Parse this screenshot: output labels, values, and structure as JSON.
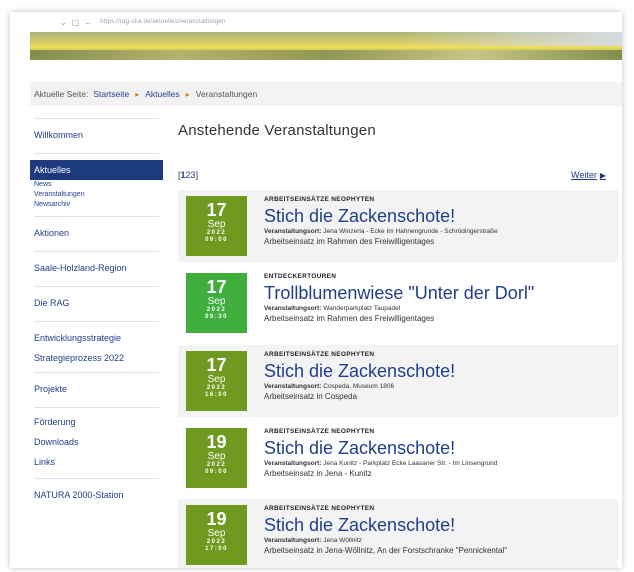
{
  "browser": {
    "url": "https://rag-sha.de/aktuelles/veranstaltungen"
  },
  "breadcrumb": {
    "label": "Aktuelle Seite:",
    "items": [
      "Startseite",
      "Aktuelles",
      "Veranstaltungen"
    ]
  },
  "sidebar": {
    "items": [
      {
        "label": "Willkommen"
      },
      {
        "label": "Aktuelles"
      },
      {
        "label": "News"
      },
      {
        "label": "Veranstaltungen"
      },
      {
        "label": "Newsarchiv"
      },
      {
        "label": "Aktionen"
      },
      {
        "label": "Saale-Holzland-Region"
      },
      {
        "label": "Die RAG"
      },
      {
        "label": "Entwicklungsstrategie"
      },
      {
        "label": "Strategieprozess 2022"
      },
      {
        "label": "Projekte"
      },
      {
        "label": "Förderung"
      },
      {
        "label": "Downloads"
      },
      {
        "label": "Links"
      },
      {
        "label": "NATURA 2000-Station"
      }
    ]
  },
  "main": {
    "heading": "Anstehende Veranstaltungen",
    "pager": {
      "open": "[",
      "p1": "1",
      "p2": "2",
      "p3": "3",
      "close": "]"
    },
    "next_label": "Weiter"
  },
  "events": [
    {
      "category": "ARBEITSEINSÄTZE NEOPHYTEN",
      "title": "Stich die Zackenschote!",
      "loc_label": "Veranstaltungsort:",
      "location": "Jena Winzerla - Ecke Im Hahnengrunde - Schrödingerstraße",
      "description": "Arbeitseinsatz im Rahmen des Freiwilligentages",
      "day": "17",
      "month": "Sep",
      "year": "2022",
      "time": "09:00",
      "color": "#6f9a1f"
    },
    {
      "category": "ENTDECKERTOUREN",
      "title": "Trollblumenwiese \"Unter der Dorl\"",
      "loc_label": "Veranstaltungsort:",
      "location": "Wanderparkplatz Taupadel",
      "description": "Arbeitseinsatz im Rahmen des Freiwilligentages",
      "day": "17",
      "month": "Sep",
      "year": "2022",
      "time": "09:30",
      "color": "#3fae3c"
    },
    {
      "category": "ARBEITSEINSÄTZE NEOPHYTEN",
      "title": "Stich die Zackenschote!",
      "loc_label": "Veranstaltungsort:",
      "location": "Cospeda, Museum 1806",
      "description": "Arbeitseinsatz in Cospeda",
      "day": "17",
      "month": "Sep",
      "year": "2022",
      "time": "16:00",
      "color": "#6f9a1f"
    },
    {
      "category": "ARBEITSEINSÄTZE NEOPHYTEN",
      "title": "Stich die Zackenschote!",
      "loc_label": "Veranstaltungsort:",
      "location": "Jena Kunitz - Parkplatz Ecke Laasaner Str. - Im Linsengrund",
      "description": "Arbeitseinsatz in Jena - Kunitz",
      "day": "19",
      "month": "Sep",
      "year": "2022",
      "time": "09:00",
      "color": "#6f9a1f"
    },
    {
      "category": "ARBEITSEINSÄTZE NEOPHYTEN",
      "title": "Stich die Zackenschote!",
      "loc_label": "Veranstaltungsort:",
      "location": "Jena Wöllnitz",
      "description": "Arbeitseinsatz in Jena-Wöllnitz, An der Forstschranke \"Pennickental\"",
      "day": "19",
      "month": "Sep",
      "year": "2022",
      "time": "17:00",
      "color": "#6f9a1f"
    }
  ]
}
